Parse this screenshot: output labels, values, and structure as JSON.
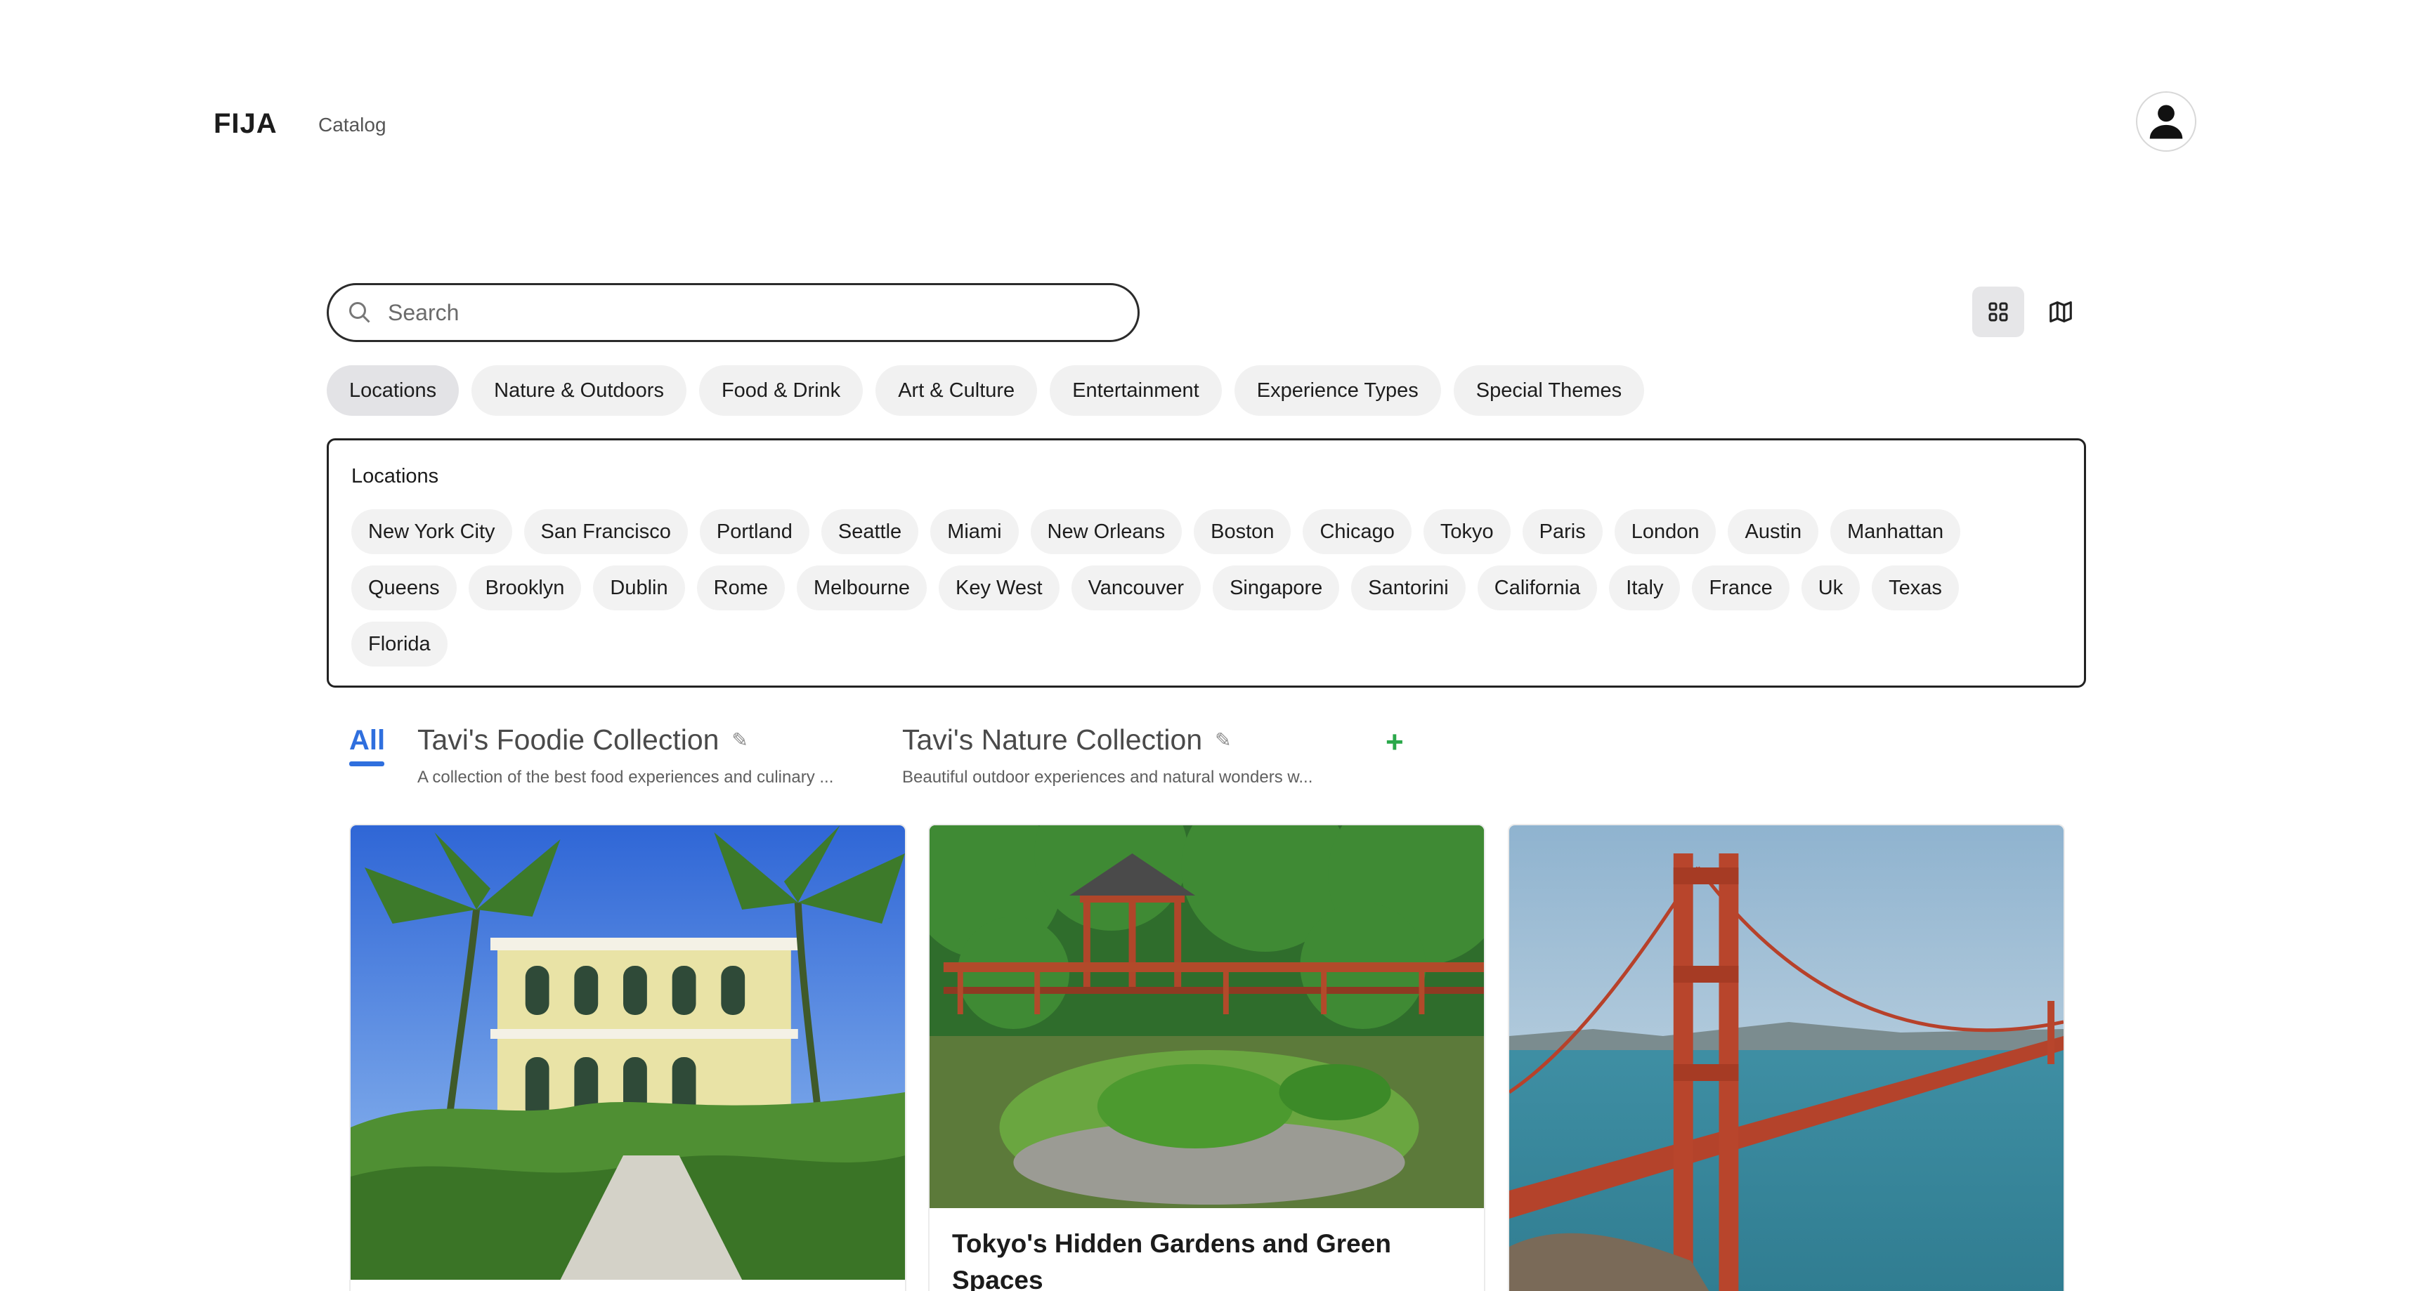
{
  "header": {
    "brand": "FIJA",
    "nav": {
      "catalog": "Catalog"
    },
    "avatar_icon": "user-icon"
  },
  "search": {
    "placeholder": "Search",
    "value": "",
    "icon": "search-icon"
  },
  "view_toggle": {
    "grid_icon": "grid-icon",
    "map_icon": "map-icon",
    "active": "grid"
  },
  "categories": [
    {
      "label": "Locations",
      "active": true
    },
    {
      "label": "Nature & Outdoors"
    },
    {
      "label": "Food & Drink"
    },
    {
      "label": "Art & Culture"
    },
    {
      "label": "Entertainment"
    },
    {
      "label": "Experience Types"
    },
    {
      "label": "Special Themes"
    }
  ],
  "locations_panel": {
    "title": "Locations",
    "items": [
      "New York City",
      "San Francisco",
      "Portland",
      "Seattle",
      "Miami",
      "New Orleans",
      "Boston",
      "Chicago",
      "Tokyo",
      "Paris",
      "London",
      "Austin",
      "Manhattan",
      "Queens",
      "Brooklyn",
      "Dublin",
      "Rome",
      "Melbourne",
      "Key West",
      "Vancouver",
      "Singapore",
      "Santorini",
      "California",
      "Italy",
      "France",
      "Uk",
      "Texas",
      "Florida"
    ]
  },
  "collections": {
    "all_label": "All",
    "items": [
      {
        "title": "Tavi's Foodie Collection",
        "description": "A collection of the best food experiences and culinary ..."
      },
      {
        "title": "Tavi's Nature Collection",
        "description": "Beautiful outdoor experiences and natural wonders w..."
      }
    ],
    "add_label": "+",
    "edit_icon": "pencil-icon",
    "accent": "#2f6fde",
    "add_color": "#2aa84a"
  },
  "cards": [
    {
      "title": "",
      "image": "key-west-house-image"
    },
    {
      "title": "Tokyo's Hidden Gardens and Green Spaces",
      "image": "japanese-garden-image"
    },
    {
      "title": "",
      "image": "golden-gate-bridge-image"
    }
  ]
}
